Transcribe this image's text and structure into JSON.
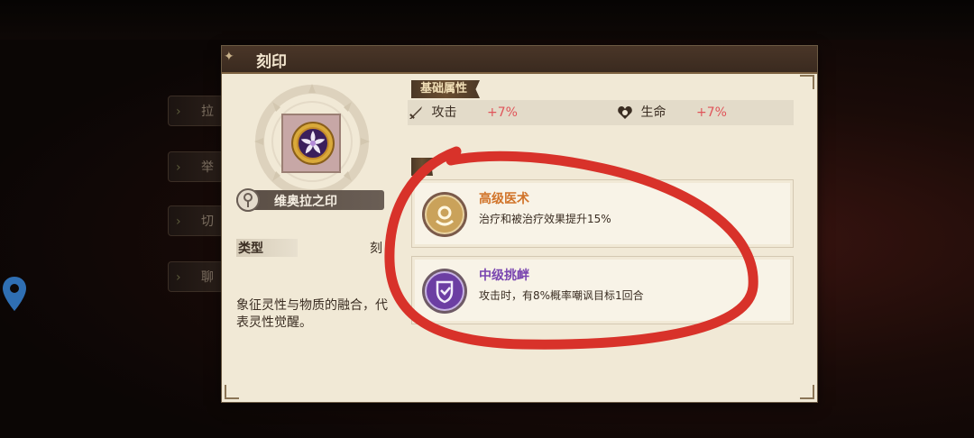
{
  "panel": {
    "title": "刻印"
  },
  "item": {
    "name": "维奥拉之印",
    "type_label": "类型",
    "type_value": "刻",
    "description": "象征灵性与物质的融合，代表灵性觉醒。"
  },
  "base_attributes": {
    "section_title": "基础属性",
    "stats": [
      {
        "icon": "sword-icon",
        "label": "攻击",
        "value": "+7%"
      },
      {
        "icon": "heart-icon",
        "label": "生命",
        "value": "+7%"
      }
    ]
  },
  "skills": {
    "section_title": "",
    "list": [
      {
        "name": "高级医术",
        "desc": "治疗和被治疗效果提升15%",
        "color": "#d1742a"
      },
      {
        "name": "中级挑衅",
        "desc": "攻击时，有8%概率嘲讽目标1回合",
        "color": "#7a46b0"
      }
    ]
  },
  "background": {
    "side_tabs": [
      "拉",
      "举",
      "切",
      "聊"
    ]
  },
  "colors": {
    "accent_red": "#e0555a",
    "annotation": "#d8322a",
    "panel_bg": "#f1e9d6",
    "header_bg": "#3a2a1f"
  }
}
